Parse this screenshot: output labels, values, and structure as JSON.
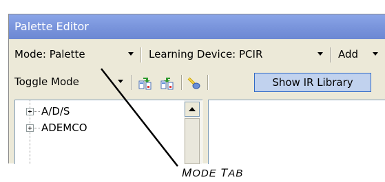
{
  "window": {
    "title": "Palette Editor"
  },
  "toolbar": {
    "mode_label": "Mode: Palette",
    "learning_device_label": "Learning Device: PCIR",
    "add_label": "Add",
    "toggle_mode_label": "Toggle Mode",
    "show_ir_library_label": "Show IR Library"
  },
  "tree": {
    "items": [
      {
        "label": "A/D/S"
      },
      {
        "label": "ADEMCO"
      }
    ]
  },
  "annotation": {
    "label_first": "M",
    "label_rest1": "ODE ",
    "label_second": "T",
    "label_rest2": "AB"
  },
  "icons": {
    "toolbar_icon_1": "import-icon",
    "toolbar_icon_2": "export-icon",
    "toolbar_icon_3": "ir-probe-icon"
  },
  "colors": {
    "titlebar": "#7a96df",
    "window_bg": "#ece9d8",
    "pressed_button_bg": "#c1d2ee",
    "pressed_button_border": "#316ac5"
  }
}
